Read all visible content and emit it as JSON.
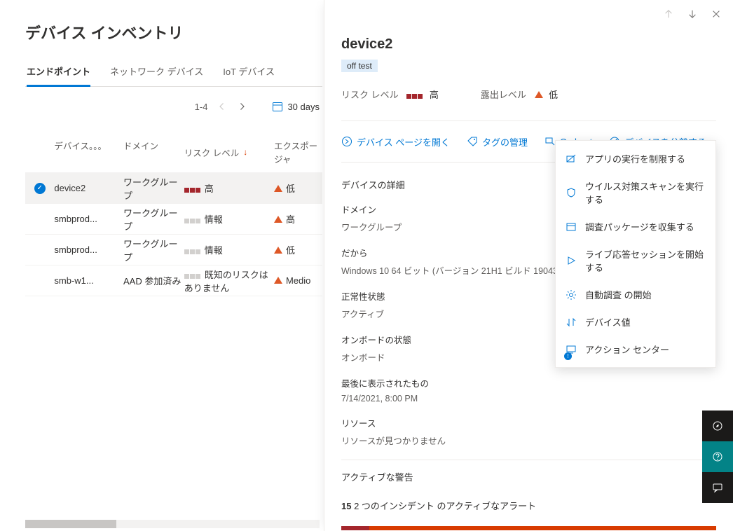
{
  "page_title": "デバイス インベントリ",
  "tabs": [
    {
      "label": "エンドポイント",
      "active": true
    },
    {
      "label": "ネットワーク デバイス",
      "active": false
    },
    {
      "label": "IoT デバイス",
      "active": false
    }
  ],
  "toolbar": {
    "range_label": "1-4",
    "date_filter": "30 days"
  },
  "columns": {
    "name": "デバイス。。。",
    "domain": "ドメイン",
    "risk": "リスク レベル",
    "exposure": "エクスポージャ"
  },
  "rows": [
    {
      "selected": true,
      "name": "device2",
      "domain": "ワークグループ",
      "risk_squares": "red3",
      "risk_label": "高",
      "exp_label": "低"
    },
    {
      "selected": false,
      "name": "smbprod...",
      "domain": "ワークグループ",
      "risk_squares": "grey3",
      "risk_label": "情報",
      "exp_label": "高"
    },
    {
      "selected": false,
      "name": "smbprod...",
      "domain": "ワークグループ",
      "risk_squares": "grey3",
      "risk_label": "情報",
      "exp_label": "低"
    },
    {
      "selected": false,
      "name": "smb-w1...",
      "domain": "AAD 参加済み",
      "risk_squares": "grey3",
      "risk_label": "既知のリスクはありません",
      "exp_label": "Medio"
    }
  ],
  "flyout": {
    "title": "device2",
    "tag": "off test",
    "risk_label": "リスク レベル",
    "risk_value": "高",
    "exposure_label": "露出レベル",
    "exposure_value": "低",
    "actions": {
      "open_page": "デバイス ページを開く",
      "manage_tags": "タグの管理",
      "go_hunt": "Go hunt",
      "isolate": "デバイスを分離する"
    },
    "details_title": "デバイスの詳細",
    "domain_k": "ドメイン",
    "domain_v": "ワークグループ",
    "os_k": "だから",
    "os_v": "Windows 10 64 ビット (バージョン 21Н1 ビルド 19043.1110)",
    "health_k": "正常性状態",
    "health_v": "アクティブ",
    "onboard_k": "オンボードの状態",
    "onboard_v": "オンボード",
    "last_seen_k": "最後に表示されたもの",
    "last_seen_v": "7/14/2021, 8:00 PM",
    "resource_k": "リソース",
    "resource_v": "リソースが見つかりません",
    "alerts_title": "アクティブな警告",
    "alerts_count_strong": "15",
    "alerts_count_text": " 2 つのインシデント のアクティブなアラート"
  },
  "menu": [
    {
      "icon": "restrict",
      "label": "アプリの実行を制限する"
    },
    {
      "icon": "shield",
      "label": "ウイルス対策スキャンを実行する"
    },
    {
      "icon": "package",
      "label": "調査パッケージを収集する"
    },
    {
      "icon": "play",
      "label": "ライブ応答セッションを開始する"
    },
    {
      "icon": "gear",
      "label": "自動調査 の開始"
    },
    {
      "icon": "swap",
      "label": "デバイス値"
    },
    {
      "icon": "screen",
      "label": "アクション センター",
      "badge": true
    }
  ]
}
